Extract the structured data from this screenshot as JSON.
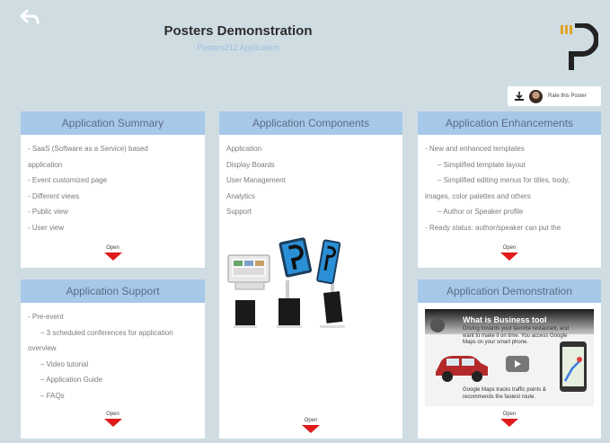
{
  "header": {
    "title": "Posters Demonstration",
    "subtitle": "Posters212 Application",
    "rate_label": "Rate this Poster"
  },
  "cards": {
    "summary": {
      "title": "Application Summary",
      "lines": [
        "- SaaS (Software as a Service) based",
        "application",
        "- Event customized page",
        "- Different views",
        "- Public view",
        "- User view"
      ],
      "open_label": "Open"
    },
    "components": {
      "title": "Application Components",
      "lines": [
        "Application",
        "Display Boards",
        "User Management",
        "Analytics",
        "Support"
      ],
      "open_label": "Open"
    },
    "enhancements": {
      "title": "Application Enhancements",
      "lines": [
        "- New and enhanced templates",
        "– Simplified template layout",
        "– Simplified editing menus for titles, body,",
        "images, color palettes and others",
        "– Author or Speaker profile",
        "- Ready status: author/speaker can put the"
      ],
      "open_label": "Open"
    },
    "support": {
      "title": "Application Support",
      "lines": [
        "- Pre-event",
        "– 3 scheduled conferences for application",
        "overview",
        "– Video tutorial",
        "– Application Guide",
        "– FAQs"
      ],
      "open_label": "Open"
    },
    "demonstration": {
      "title": "Application Demonstration",
      "video_title": "What is Business tool",
      "video_caption_top": "Driving towards your favorite restaurant, and want to make it on time. You access Google Maps on your smart phone.",
      "video_caption_bottom": "Google Maps tracks traffic points & recommends the fastest route.",
      "open_label": "Open"
    }
  },
  "colors": {
    "background": "#cfdde3",
    "card_header": "#a8c8ea",
    "open_arrow": "#e01b1b"
  }
}
